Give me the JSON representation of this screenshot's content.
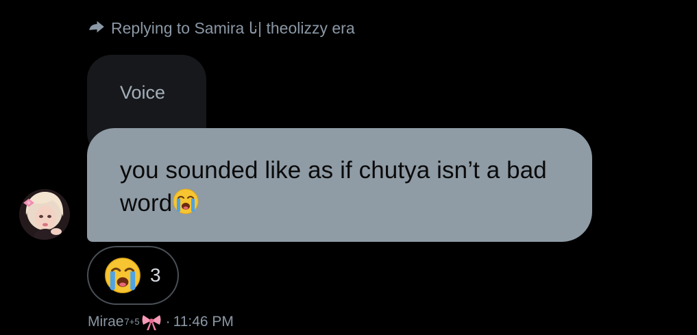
{
  "reply_context": {
    "text": "Replying to Samira نا| theolizzy era"
  },
  "quoted_message": {
    "text": "Voice"
  },
  "message": {
    "text": "you sounded like as if chutya isn’t a bad word",
    "emoji": "loudly-crying-face"
  },
  "reaction": {
    "emoji": "loudly-crying-face",
    "count": "3"
  },
  "meta": {
    "sender_name": "Mirae",
    "sender_superscript": "7+5",
    "sender_decoration": "pink-bow-icon",
    "separator": "·",
    "time": "11:46 PM"
  },
  "colors": {
    "background": "#000000",
    "message_bubble": "#8f9ba5",
    "quoted_bubble": "#16181c",
    "muted_text": "#8b98a5",
    "reaction_border": "#4a5057"
  }
}
